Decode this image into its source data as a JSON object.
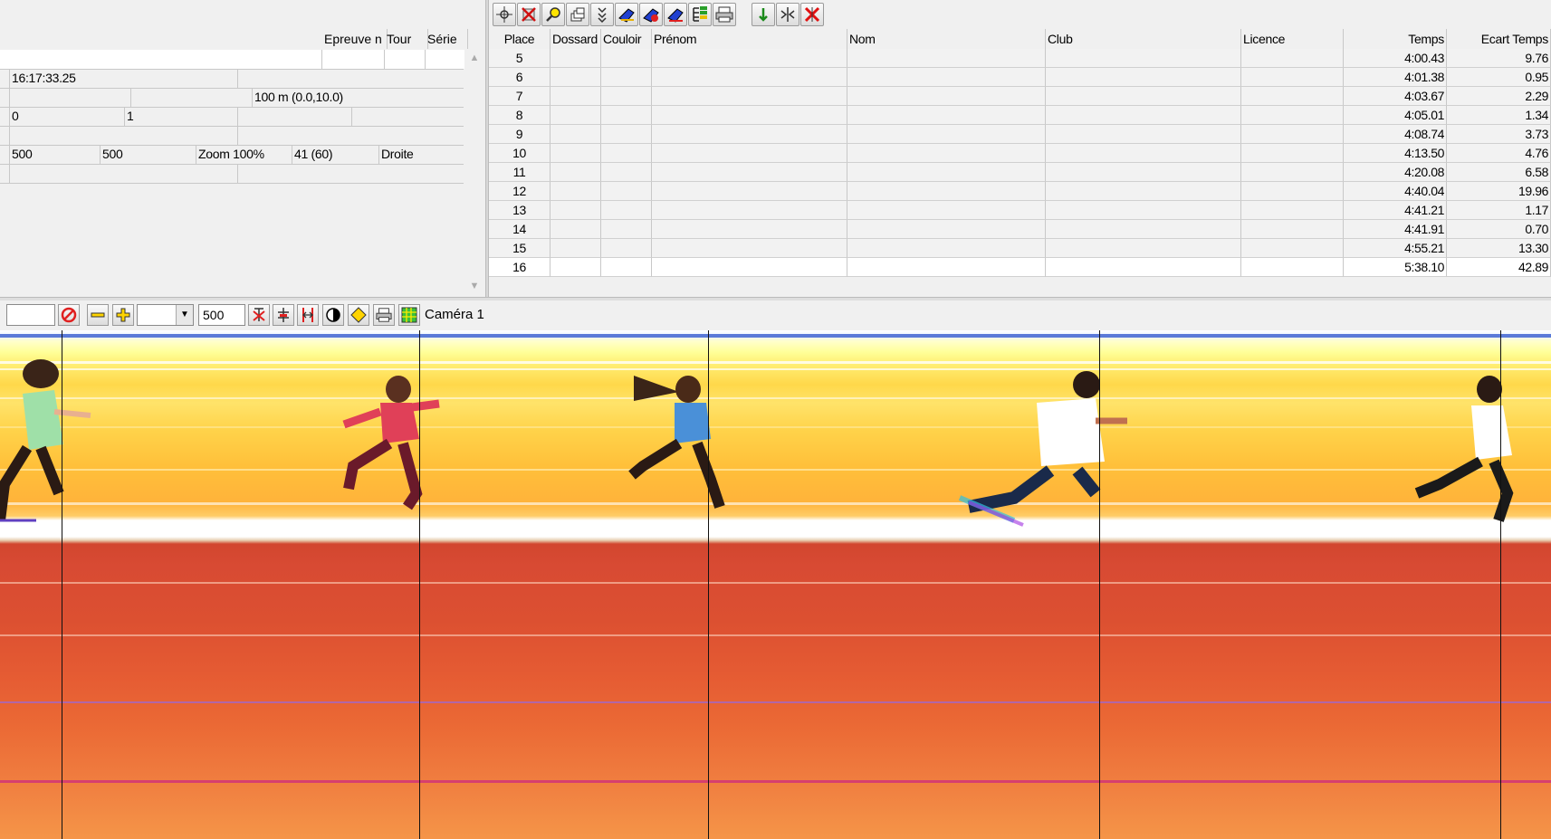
{
  "left_panel": {
    "headers": [
      "Epreuve n",
      "Tour",
      "Série"
    ],
    "rows": {
      "time": "16:17:33.25",
      "distance": "100 m (0.0,10.0)",
      "zero": "0",
      "one": "1",
      "val_a": "500",
      "val_b": "500",
      "zoom": "Zoom 100%",
      "frames": "41  (60)",
      "side": "Droite"
    }
  },
  "toolbar": {
    "icons": [
      "cross-hairs-icon",
      "delete-icon",
      "search-icon",
      "stack-icon",
      "down-arrows-icon",
      "shoe-blue-icon",
      "shoe-red-icon",
      "shoe-multi-icon",
      "tree-icon",
      "print-icon",
      "check-down-icon",
      "split-icon",
      "remove-icon"
    ]
  },
  "results": {
    "columns": [
      "Place",
      "Dossard",
      "Couloir",
      "Prénom",
      "Nom",
      "Club",
      "Licence",
      "Temps",
      "Ecart Temps"
    ],
    "rows": [
      {
        "place": "5",
        "temps": "4:00.43",
        "ecart": "9.76"
      },
      {
        "place": "6",
        "temps": "4:01.38",
        "ecart": "0.95"
      },
      {
        "place": "7",
        "temps": "4:03.67",
        "ecart": "2.29"
      },
      {
        "place": "8",
        "temps": "4:05.01",
        "ecart": "1.34"
      },
      {
        "place": "9",
        "temps": "4:08.74",
        "ecart": "3.73"
      },
      {
        "place": "10",
        "temps": "4:13.50",
        "ecart": "4.76"
      },
      {
        "place": "11",
        "temps": "4:20.08",
        "ecart": "6.58"
      },
      {
        "place": "12",
        "temps": "4:40.04",
        "ecart": "19.96"
      },
      {
        "place": "13",
        "temps": "4:41.21",
        "ecart": "1.17"
      },
      {
        "place": "14",
        "temps": "4:41.91",
        "ecart": "0.70"
      },
      {
        "place": "15",
        "temps": "4:55.21",
        "ecart": "13.30"
      },
      {
        "place": "16",
        "temps": "5:38.10",
        "ecart": "42.89"
      }
    ]
  },
  "photo_toolbar": {
    "time_value": "",
    "step_value": "500",
    "camera_label": "Caméra 1"
  },
  "colors": {
    "accent_red": "#e02020",
    "track_red": "#d84a33",
    "lane_yellow": "#ffd84a"
  }
}
